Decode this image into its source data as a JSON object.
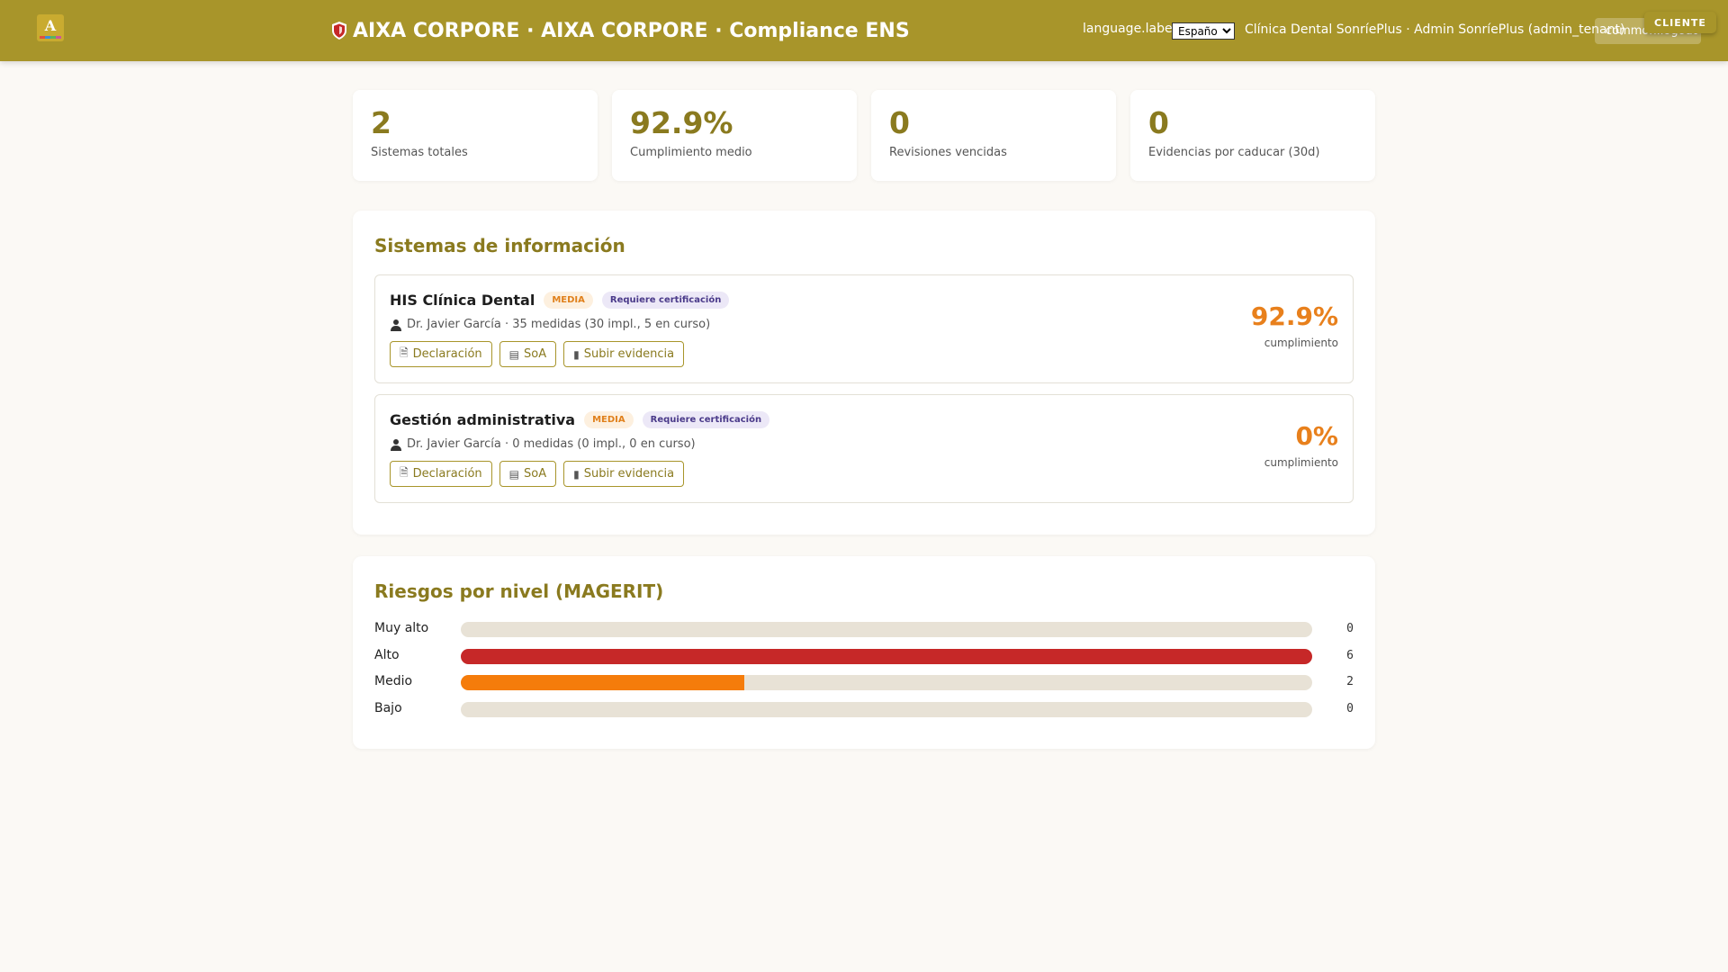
{
  "header": {
    "app_title": "AIXA CORPORE · AIXA CORPORE · Compliance ENS",
    "language_label": "language.label",
    "language_selected": "Español",
    "user_info": "Clínica Dental SonríePlus · Admin SonríePlus (admin_tenant)",
    "logout_label": "common.logout",
    "role_badge": "CLIENTE",
    "logo_icon": "aixa-logo",
    "brand_color": "#a8952a"
  },
  "stats": [
    {
      "value": "2",
      "label": "Sistemas totales"
    },
    {
      "value": "92.9%",
      "label": "Cumplimiento medio"
    },
    {
      "value": "0",
      "label": "Revisiones vencidas"
    },
    {
      "value": "0",
      "label": "Evidencias por caducar (30d)"
    }
  ],
  "systems_panel": {
    "title": "Sistemas de información",
    "items": [
      {
        "name": "HIS Clínica Dental",
        "level": "MEDIA",
        "cert": "Requiere certificación",
        "meta": "Dr. Javier García · 35 medidas (30 impl., 5 en curso)",
        "actions": {
          "declaration": "Declaración",
          "soa": "SoA",
          "upload": "Subir evidencia"
        },
        "percent": "92.9%",
        "percent_label": "cumplimiento"
      },
      {
        "name": "Gestión administrativa",
        "level": "MEDIA",
        "cert": "Requiere certificación",
        "meta": "Dr. Javier García · 0 medidas (0 impl., 0 en curso)",
        "actions": {
          "declaration": "Declaración",
          "soa": "SoA",
          "upload": "Subir evidencia"
        },
        "percent": "0%",
        "percent_label": "cumplimiento"
      }
    ]
  },
  "risk_panel": {
    "title": "Riesgos por nivel (MAGERIT)",
    "max": 6,
    "levels": [
      {
        "label": "Muy alto",
        "count": 0,
        "color": "#c0392b"
      },
      {
        "label": "Alto",
        "count": 6,
        "color": "#c62828"
      },
      {
        "label": "Medio",
        "count": 2,
        "color": "#f57c0b"
      },
      {
        "label": "Bajo",
        "count": 0,
        "color": "#2e7d32"
      }
    ]
  }
}
